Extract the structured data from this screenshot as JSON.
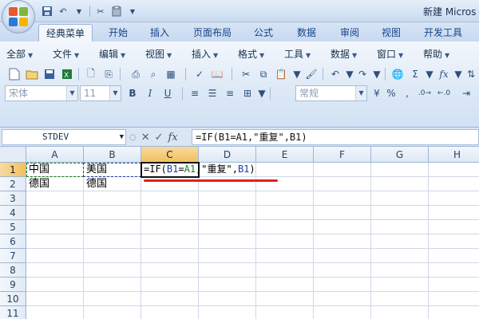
{
  "titlebar": {
    "title": "新建 Micros",
    "qat_icons": [
      "save-icon",
      "undo-icon",
      "chevron-down-icon",
      "tools-icon",
      "clipboard-icon",
      "chevron-down-icon"
    ]
  },
  "tabs": [
    {
      "label": "经典菜单",
      "active": true
    },
    {
      "label": "开始",
      "active": false
    },
    {
      "label": "插入",
      "active": false
    },
    {
      "label": "页面布局",
      "active": false
    },
    {
      "label": "公式",
      "active": false
    },
    {
      "label": "数据",
      "active": false
    },
    {
      "label": "审阅",
      "active": false
    },
    {
      "label": "视图",
      "active": false
    },
    {
      "label": "开发工具",
      "active": false
    }
  ],
  "menus": [
    {
      "label": "全部"
    },
    {
      "label": "文件"
    },
    {
      "label": "编辑"
    },
    {
      "label": "视图"
    },
    {
      "label": "插入"
    },
    {
      "label": "格式"
    },
    {
      "label": "工具"
    },
    {
      "label": "数据"
    },
    {
      "label": "窗口"
    },
    {
      "label": "帮助"
    }
  ],
  "format_row": {
    "font_name": "宋体",
    "font_size": "11",
    "number_format": "常规",
    "bold": "B",
    "italic": "I",
    "underline": "U",
    "percent": "%",
    "comma": ","
  },
  "formula_bar": {
    "name_box": "STDEV",
    "cancel": "✕",
    "enter": "✓",
    "fx": "fx",
    "formula": "=IF(B1=A1,\"重复\",B1)"
  },
  "grid": {
    "columns": [
      "A",
      "B",
      "C",
      "D",
      "E",
      "F",
      "G",
      "H"
    ],
    "selected_column": "C",
    "rows": [
      "1",
      "2",
      "3",
      "4",
      "5",
      "6",
      "7",
      "8",
      "9",
      "10",
      "11"
    ],
    "selected_row": "1",
    "cells": {
      "A1": "中国",
      "B1": "美国",
      "A2": "德国",
      "B2": "德国"
    },
    "formula_parts": {
      "p1": "=IF(",
      "p2": "B1",
      "p3": "=",
      "p4": "A1",
      "p5": ",\"重复\",",
      "p6": "B1",
      "p7": ")"
    }
  },
  "colors": {
    "accent_underline": "#e02020",
    "ref_b1": "#1a3aa8",
    "ref_a1": "#1f7a1f",
    "selected_header": "#f1c15f"
  }
}
